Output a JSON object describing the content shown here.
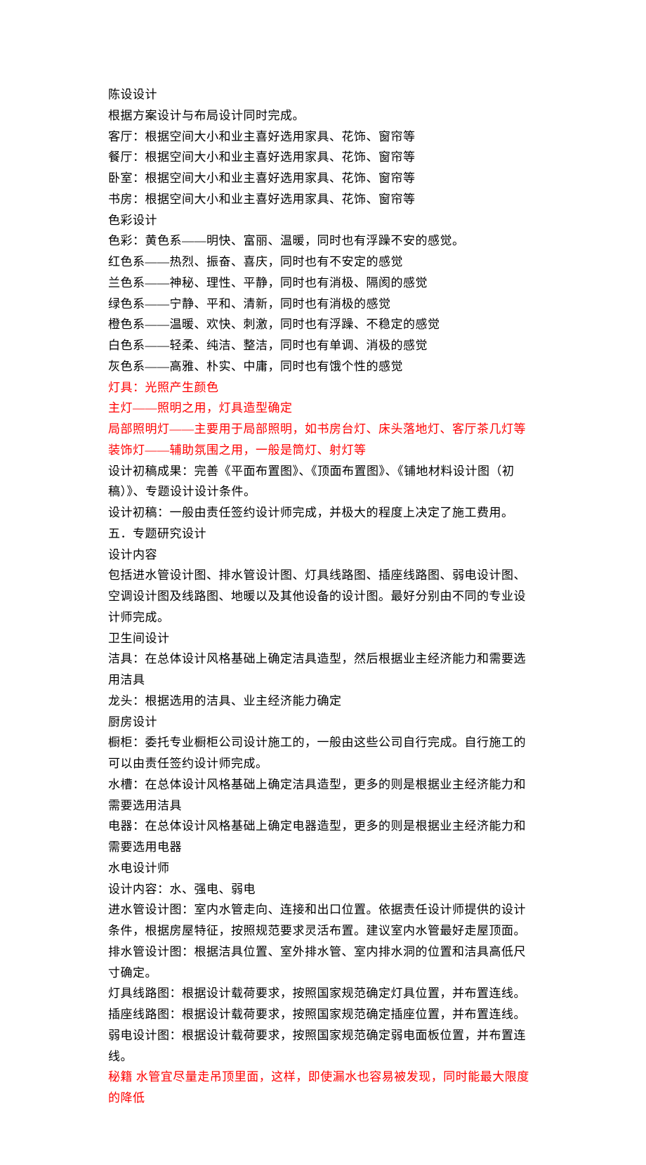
{
  "lines": [
    {
      "text": "陈设设计",
      "red": false
    },
    {
      "text": "根据方案设计与布局设计同时完成。",
      "red": false
    },
    {
      "text": "客厅：根据空间大小和业主喜好选用家具、花饰、窗帘等",
      "red": false
    },
    {
      "text": "餐厅：根据空间大小和业主喜好选用家具、花饰、窗帘等",
      "red": false
    },
    {
      "text": "卧室：根据空间大小和业主喜好选用家具、花饰、窗帘等",
      "red": false
    },
    {
      "text": "书房：根据空间大小和业主喜好选用家具、花饰、窗帘等",
      "red": false
    },
    {
      "text": "色彩设计",
      "red": false
    },
    {
      "text": "色彩：黄色系——明快、富丽、温暖，同时也有浮躁不安的感觉。",
      "red": false
    },
    {
      "text": "红色系——热烈、振奋、喜庆，同时也有不安定的感觉",
      "red": false
    },
    {
      "text": "兰色系——神秘、理性、平静，同时也有消极、隔阂的感觉",
      "red": false
    },
    {
      "text": "绿色系——宁静、平和、清新，同时也有消极的感觉",
      "red": false
    },
    {
      "text": "橙色系——温暖、欢快、刺激，同时也有浮躁、不稳定的感觉",
      "red": false
    },
    {
      "text": "白色系——轻柔、纯洁、整洁，同时也有单调、消极的感觉",
      "red": false
    },
    {
      "text": "灰色系——高雅、朴实、中庸，同时也有饿个性的感觉",
      "red": false
    },
    {
      "text": "灯具：光照产生颜色",
      "red": true
    },
    {
      "text": "主灯——照明之用，灯具造型确定",
      "red": true
    },
    {
      "text": "局部照明灯——主要用于局部照明，如书房台灯、床头落地灯、客厅茶几灯等",
      "red": true
    },
    {
      "text": "装饰灯——辅助氛围之用，一般是筒灯、射灯等",
      "red": true
    },
    {
      "text": "设计初稿成果：完善《平面布置图》、《顶面布置图》、《铺地材料设计图（初稿）》、专题设计设计条件。",
      "red": false
    },
    {
      "text": "设计初稿：一般由责任签约设计师完成，并极大的程度上决定了施工费用。",
      "red": false
    },
    {
      "text": "五．专题研究设计",
      "red": false
    },
    {
      "text": "设计内容",
      "red": false
    },
    {
      "text": "包括进水管设计图、排水管设计图、灯具线路图、插座线路图、弱电设计图、空调设计图及线路图、地暖以及其他设备的设计图。最好分别由不同的专业设计师完成。",
      "red": false
    },
    {
      "text": "卫生间设计",
      "red": false
    },
    {
      "text": "洁具：在总体设计风格基础上确定洁具造型，然后根据业主经济能力和需要选用洁具",
      "red": false
    },
    {
      "text": "龙头：根据选用的洁具、业主经济能力确定",
      "red": false
    },
    {
      "text": "厨房设计",
      "red": false
    },
    {
      "text": "橱柜：委托专业橱柜公司设计施工的，一般由这些公司自行完成。自行施工的可以由责任签约设计师完成。",
      "red": false
    },
    {
      "text": "水槽：在总体设计风格基础上确定洁具造型，更多的则是根据业主经济能力和需要选用洁具",
      "red": false
    },
    {
      "text": "电器：在总体设计风格基础上确定电器造型，更多的则是根据业主经济能力和需要选用电器",
      "red": false
    },
    {
      "text": "水电设计师",
      "red": false
    },
    {
      "text": "设计内容：水、强电、弱电",
      "red": false
    },
    {
      "text": "进水管设计图：室内水管走向、连接和出口位置。依据责任设计师提供的设计条件，根据房屋特征，按照规范要求灵活布置。建议室内水管最好走屋顶面。",
      "red": false
    },
    {
      "text": "排水管设计图：根据洁具位置、室外排水管、室内排水洞的位置和洁具高低尺寸确定。",
      "red": false
    },
    {
      "text": "灯具线路图：根据设计载荷要求，按照国家规范确定灯具位置，并布置连线。",
      "red": false
    },
    {
      "text": "插座线路图：根据设计载荷要求，按照国家规范确定插座位置，并布置连线。",
      "red": false
    },
    {
      "text": "弱电设计图：根据设计载荷要求，按照国家规范确定弱电面板位置，并布置连线。",
      "red": false
    },
    {
      "text": "秘籍 水管宜尽量走吊顶里面，这样，即使漏水也容易被发现，同时能最大限度的降低",
      "red": true
    }
  ]
}
